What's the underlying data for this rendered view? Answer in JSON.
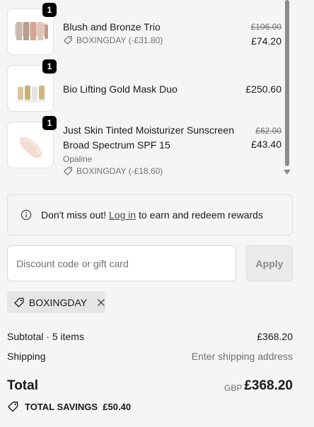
{
  "cart": {
    "items": [
      {
        "qty": "1",
        "name": "Blush and Bronze Trio",
        "discount": "BOXINGDAY (-£31.80)",
        "original_price": "£106.00",
        "price": "£74.20"
      },
      {
        "qty": "1",
        "name": "Bio Lifting Gold Mask Duo",
        "price": "£250.60"
      },
      {
        "qty": "1",
        "name_line1": "Just Skin Tinted Moisturizer Sunscreen",
        "name_line2": "Broad Spectrum SPF 15",
        "vendor": "Opaline",
        "discount": "BOXINGDAY (-£18.60)",
        "original_price": "£62.00",
        "price": "£43.40"
      }
    ]
  },
  "rewards": {
    "prefix": "Don't miss out!",
    "link": "Log in",
    "suffix": "to earn and redeem rewards"
  },
  "discount": {
    "placeholder": "Discount code or gift card",
    "apply_label": "Apply",
    "applied_code": "BOXINGDAY"
  },
  "summary": {
    "subtotal_label": "Subtotal · 5 items",
    "subtotal_value": "£368.20",
    "shipping_label": "Shipping",
    "shipping_value": "Enter shipping address",
    "total_label": "Total",
    "currency": "GBP",
    "total_value": "£368.20",
    "savings_label": "TOTAL SAVINGS",
    "savings_value": "£50.40"
  },
  "icons": {
    "tag": "tag-icon",
    "info": "info-icon",
    "close": "close-icon",
    "savings": "savings-tag-icon"
  },
  "colors": {
    "background": "#f5f5f5",
    "text": "#1a1a1a",
    "muted": "#707070",
    "badge": "#000000"
  }
}
